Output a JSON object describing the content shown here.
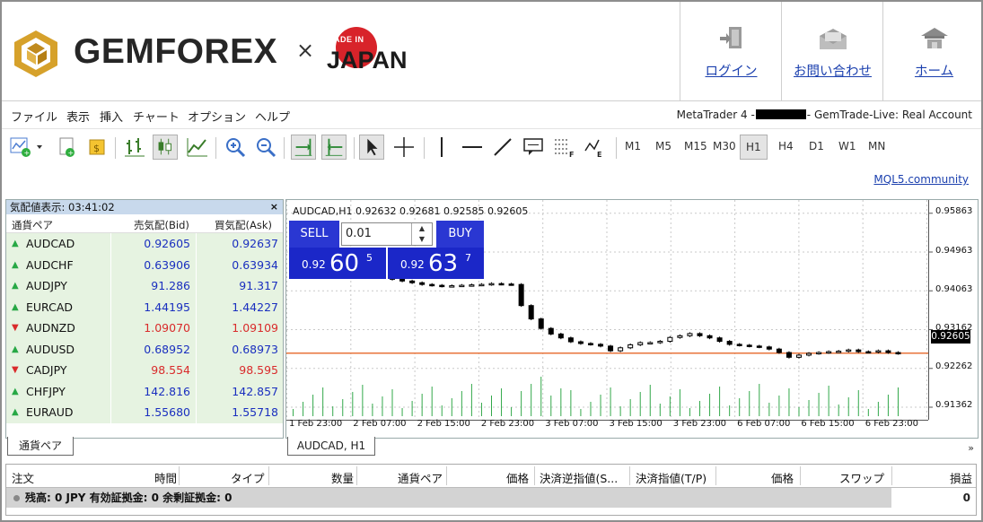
{
  "header": {
    "brand": "GEMFOREX",
    "times_sign": "×",
    "made_in": "MADE IN",
    "japan": "JAPAN",
    "nav": [
      {
        "label": "ログイン",
        "icon": "login-door-icon"
      },
      {
        "label": "お問い合わせ",
        "icon": "mail-envelope-icon"
      },
      {
        "label": "ホーム",
        "icon": "home-icon"
      }
    ]
  },
  "menu": {
    "items": [
      "ファイル",
      "表示",
      "挿入",
      "チャート",
      "オプション",
      "ヘルプ"
    ],
    "account_prefix": "MetaTrader 4 -",
    "account_suffix": "- GemTrade-Live: Real Account"
  },
  "toolbar": {
    "timeframes": [
      "M1",
      "M5",
      "M15",
      "M30",
      "H1",
      "H4",
      "D1",
      "W1",
      "MN"
    ],
    "active_timeframe": "H1",
    "mql5_link": "MQL5.community"
  },
  "market_watch": {
    "title": "気配値表示: 03:41:02",
    "close": "×",
    "columns": [
      "通貨ペア",
      "売気配(Bid)",
      "買気配(Ask)"
    ],
    "rows": [
      {
        "symbol": "AUDCAD",
        "bid": "0.92605",
        "ask": "0.92637",
        "dir": "up"
      },
      {
        "symbol": "AUDCHF",
        "bid": "0.63906",
        "ask": "0.63934",
        "dir": "up"
      },
      {
        "symbol": "AUDJPY",
        "bid": "91.286",
        "ask": "91.317",
        "dir": "up"
      },
      {
        "symbol": "EURCAD",
        "bid": "1.44195",
        "ask": "1.44227",
        "dir": "up"
      },
      {
        "symbol": "AUDNZD",
        "bid": "1.09070",
        "ask": "1.09109",
        "dir": "down"
      },
      {
        "symbol": "AUDUSD",
        "bid": "0.68952",
        "ask": "0.68973",
        "dir": "up"
      },
      {
        "symbol": "CADJPY",
        "bid": "98.554",
        "ask": "98.595",
        "dir": "down"
      },
      {
        "symbol": "CHFJPY",
        "bid": "142.816",
        "ask": "142.857",
        "dir": "up"
      },
      {
        "symbol": "EURAUD",
        "bid": "1.55680",
        "ask": "1.55718",
        "dir": "up"
      }
    ],
    "tab_label": "通貨ペア"
  },
  "chart": {
    "title": "AUDCAD,H1  0.92632 0.92681 0.92585 0.92605",
    "tab_label": "AUDCAD, H1",
    "more": "»",
    "sell_label": "SELL",
    "buy_label": "BUY",
    "lot": "0.01",
    "sell_quote": {
      "big_prefix": "0.92",
      "big": "60",
      "pip": "5"
    },
    "buy_quote": {
      "big_prefix": "0.92",
      "big": "63",
      "pip": "7"
    },
    "current_price": "0.92605",
    "price_line_color": "#e8743b"
  },
  "chart_data": {
    "type": "candlestick",
    "y_ticks": [
      "0.95863",
      "0.94963",
      "0.94063",
      "0.93162",
      "0.92262",
      "0.91362"
    ],
    "x_ticks": [
      "1 Feb 23:00",
      "2 Feb 07:00",
      "2 Feb 15:00",
      "2 Feb 23:00",
      "3 Feb 07:00",
      "3 Feb 15:00",
      "3 Feb 23:00",
      "6 Feb 07:00",
      "6 Feb 15:00",
      "6 Feb 23:00"
    ],
    "ylim": [
      0.9106,
      0.9616
    ],
    "closes": [
      0.9472,
      0.9468,
      0.9462,
      0.9458,
      0.9452,
      0.9448,
      0.9445,
      0.9442,
      0.944,
      0.9436,
      0.9432,
      0.9428,
      0.9424,
      0.942,
      0.9418,
      0.9416,
      0.9417,
      0.9418,
      0.9419,
      0.942,
      0.9422,
      0.9421,
      0.942,
      0.9371,
      0.934,
      0.9318,
      0.9305,
      0.9296,
      0.9287,
      0.9283,
      0.9281,
      0.9277,
      0.9266,
      0.9273,
      0.928,
      0.9285,
      0.9285,
      0.9288,
      0.9297,
      0.9301,
      0.9306,
      0.9301,
      0.9296,
      0.9288,
      0.9281,
      0.9279,
      0.9277,
      0.9275,
      0.927,
      0.9262,
      0.9251,
      0.9256,
      0.926,
      0.9262,
      0.9264,
      0.9265,
      0.9268,
      0.9264,
      0.9263,
      0.9266,
      0.9262,
      0.926
    ],
    "bullish_color": "#ffffff",
    "bearish_color": "#000000",
    "volume_color": "#32a84a"
  },
  "bottom_panel": {
    "columns": [
      "注文",
      "時間",
      "タイプ",
      "数量",
      "通貨ペア",
      "価格",
      "決済逆指値(S...",
      "決済指値(T/P)",
      "価格",
      "スワップ",
      "損益"
    ],
    "balance_line": "残高: 0 JPY  有効証拠金: 0  余剰証拠金: 0",
    "pl_value": "0"
  },
  "colors": {
    "up": "#27a845",
    "down": "#d92b2b",
    "quote_blue": "#1b27c8"
  }
}
